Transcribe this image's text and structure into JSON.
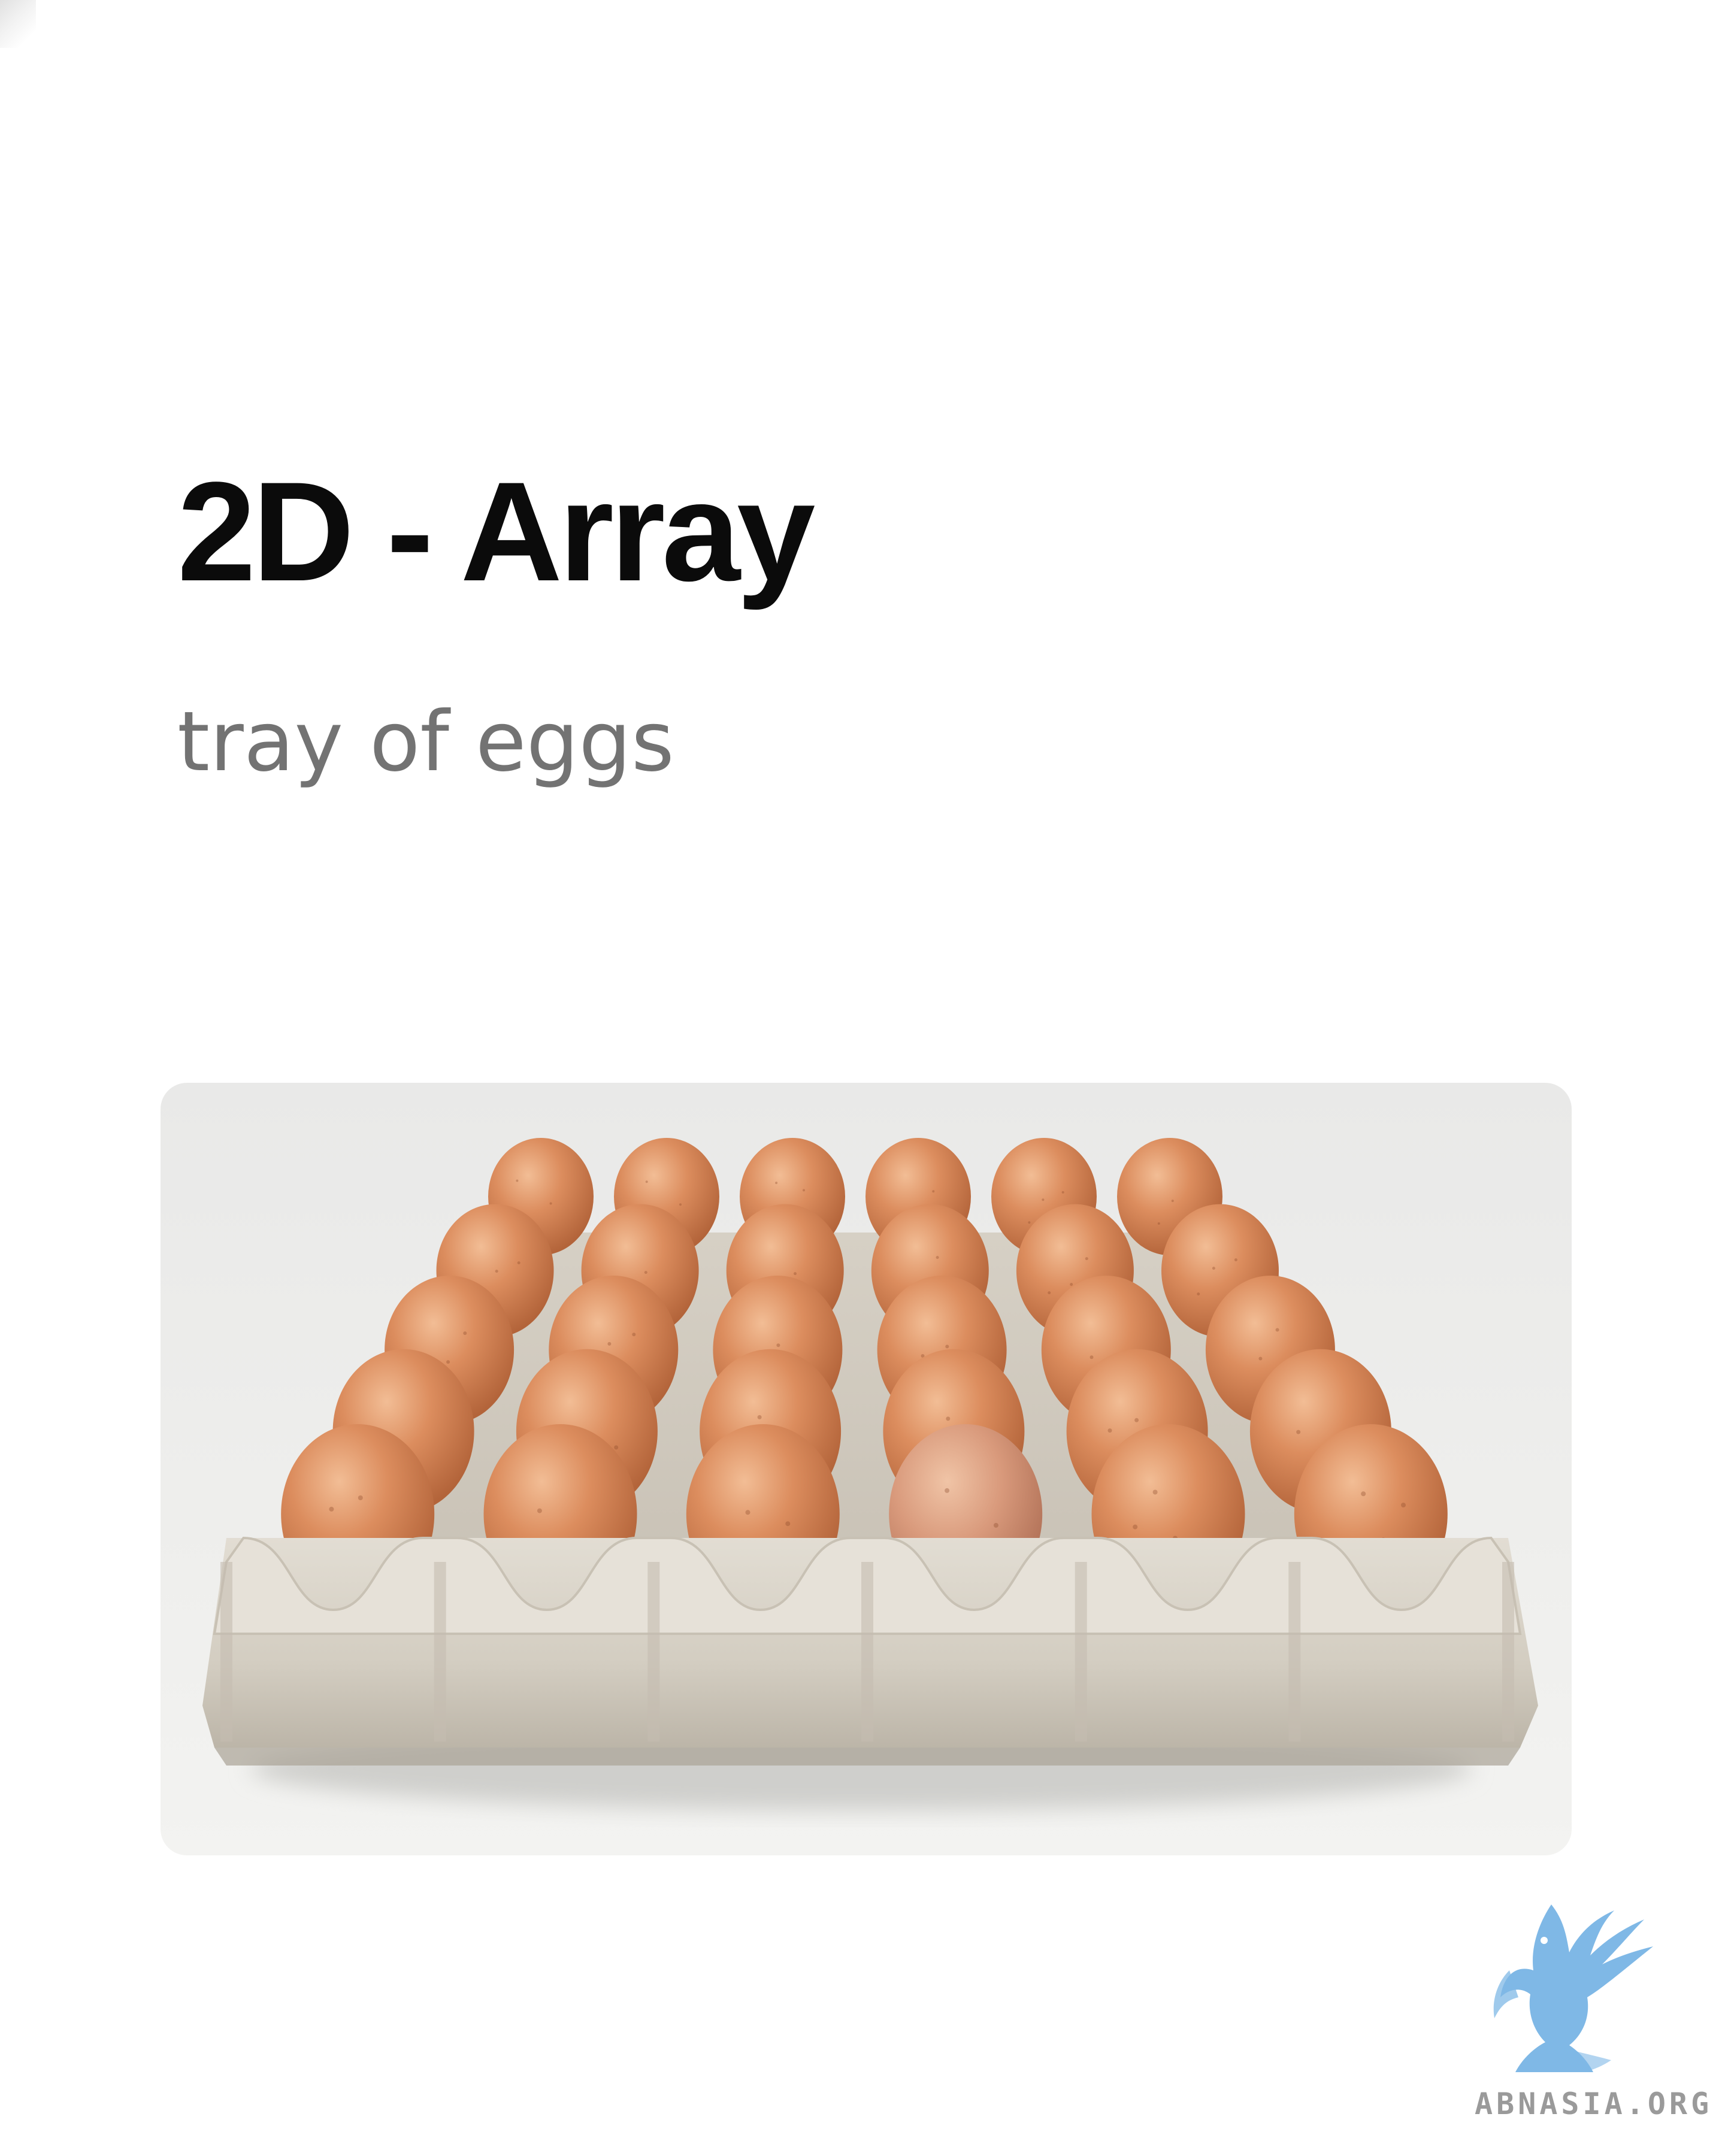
{
  "slide": {
    "title": "2D - Array",
    "subtitle": "tray of eggs"
  },
  "photo": {
    "subject": "egg tray",
    "rows": 5,
    "columns": 6,
    "colors": {
      "egg": "#d9895a",
      "egg_highlight": "#efb68d",
      "egg_shadow": "#b06338",
      "tray": "#d8d3c9",
      "tray_shadow": "#bdb6aa",
      "card_background": "#ececea"
    }
  },
  "watermark": {
    "text": "ABNASIA.ORG",
    "icon": "griffin-logo-icon",
    "color": "#7fb8e6"
  }
}
